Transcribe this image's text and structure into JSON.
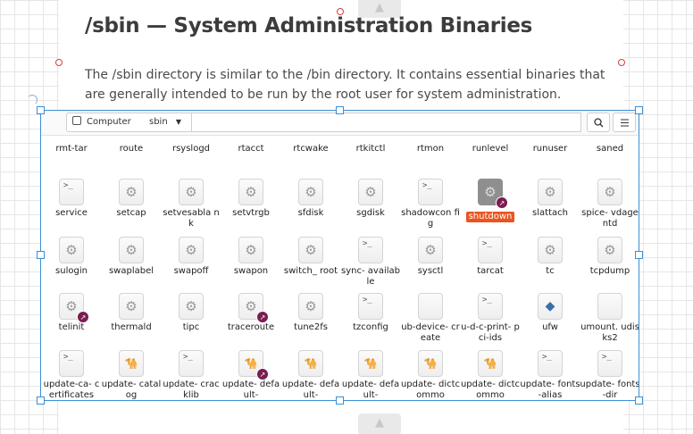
{
  "slide": {
    "title": "/sbin — System Administration Binaries",
    "paragraph": "The /sbin directory is similar to the /bin directory. It contains essential binaries that are generally intended to be run by the root user for system administration."
  },
  "toolbar": {
    "crumbs": [
      "Computer",
      "sbin"
    ],
    "search_icon": "search-icon",
    "view_icon": "list-view-icon"
  },
  "files": {
    "row0": [
      "rmt-tar",
      "route",
      "rsyslogd",
      "rtacct",
      "rtcwake",
      "rtkitctl",
      "rtmon",
      "runlevel",
      "runuser",
      "saned"
    ],
    "row1": [
      "service",
      "setcap",
      "setvesabla nk",
      "setvtrgb",
      "sfdisk",
      "sgdisk",
      "shadowcon fig",
      "shutdown",
      "slattach",
      "spice- vdagentd"
    ],
    "row2": [
      "sulogin",
      "swaplabel",
      "swapoff",
      "swapon",
      "switch_ root",
      "sync- available",
      "sysctl",
      "tarcat",
      "tc",
      "tcpdump"
    ],
    "row3": [
      "telinit",
      "thermald",
      "tipc",
      "traceroute",
      "tune2fs",
      "tzconfig",
      "ub-device- create",
      "u-d-c-print- pci-ids",
      "ufw",
      "umount. udisks2"
    ],
    "row4": [
      "update-ca- certificates",
      "update- catalog",
      "update- cracklib",
      "update- default-",
      "update- default-",
      "update- default-",
      "update- dictcommo",
      "update- dictcommo",
      "update- fonts-alias",
      "update- fonts-dir"
    ]
  },
  "selected_file": "shutdown",
  "colors": {
    "accent": "#e95420",
    "selection_border": "#3a8fd6",
    "badge": "#7a1d4f"
  }
}
